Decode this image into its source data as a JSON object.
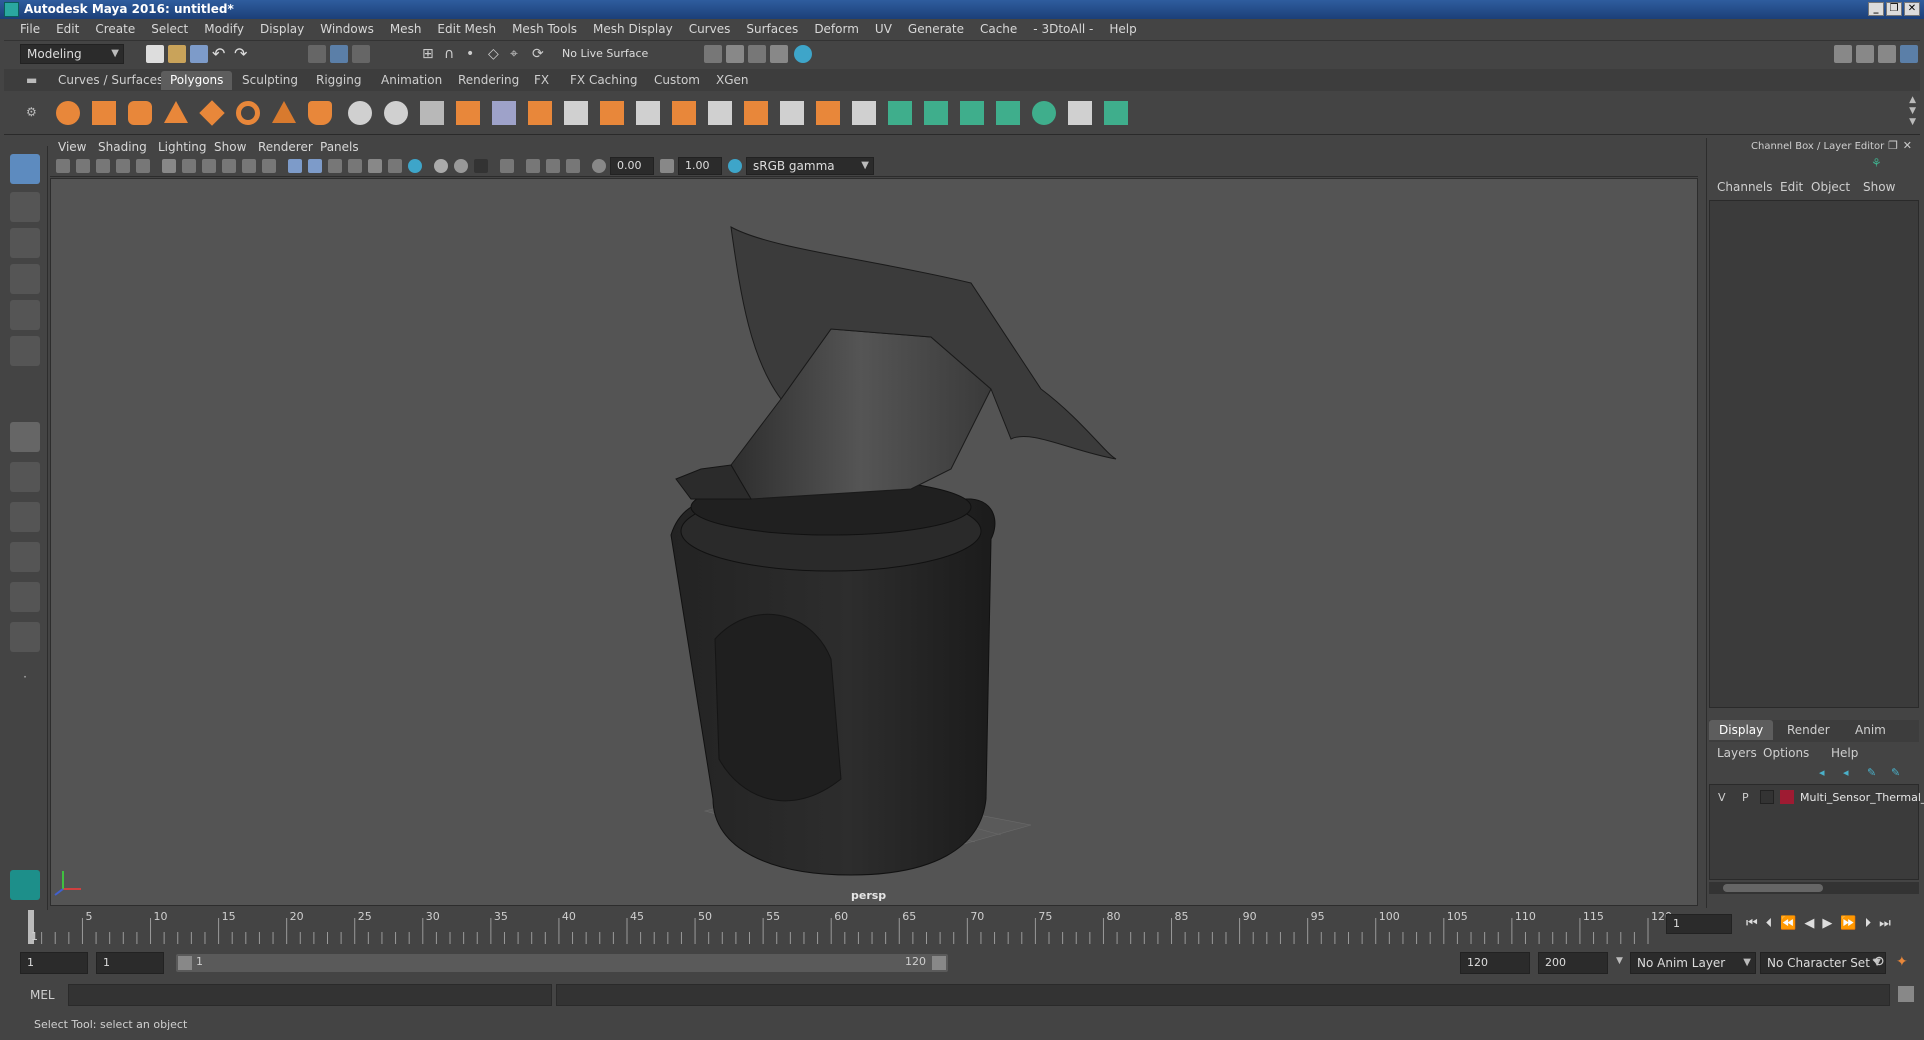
{
  "window": {
    "title": "Autodesk Maya 2016: untitled*",
    "controls": [
      "minimize-icon",
      "restore-icon",
      "close-icon"
    ]
  },
  "menubar": [
    "File",
    "Edit",
    "Create",
    "Select",
    "Modify",
    "Display",
    "Windows",
    "Mesh",
    "Edit Mesh",
    "Mesh Tools",
    "Mesh Display",
    "Curves",
    "Surfaces",
    "Deform",
    "UV",
    "Generate",
    "Cache",
    "- 3DtoAll -",
    "Help"
  ],
  "status": {
    "mode": "Modeling",
    "live_surface": "No Live Surface"
  },
  "shelf": {
    "tabs": [
      "Curves / Surfaces",
      "Polygons",
      "Sculpting",
      "Rigging",
      "Animation",
      "Rendering",
      "FX",
      "FX Caching",
      "Custom",
      "XGen"
    ],
    "active_tab": "Polygons"
  },
  "panel": {
    "menus": [
      "View",
      "Shading",
      "Lighting",
      "Show",
      "Renderer",
      "Panels"
    ],
    "exposure": "0.00",
    "gamma": "1.00",
    "color_space": "sRGB gamma",
    "camera_label": "persp"
  },
  "channel_box": {
    "title": "Channel Box / Layer Editor",
    "menus": [
      "Channels",
      "Edit",
      "Object",
      "Show"
    ]
  },
  "layer_editor": {
    "tabs": [
      "Display",
      "Render",
      "Anim"
    ],
    "active_tab": "Display",
    "menus": [
      "Layers",
      "Options",
      "Help"
    ],
    "layers": [
      {
        "v": "V",
        "p": "P",
        "color": "#9e1b32",
        "name": "Multi_Sensor_Thermal_"
      }
    ]
  },
  "timeline": {
    "ticks": [
      "1",
      "5",
      "10",
      "15",
      "20",
      "25",
      "30",
      "35",
      "40",
      "45",
      "50",
      "55",
      "60",
      "65",
      "70",
      "75",
      "80",
      "85",
      "90",
      "95",
      "100",
      "105",
      "110",
      "115",
      "120"
    ],
    "current_frame": "1"
  },
  "range": {
    "start": "1",
    "playback_start": "1",
    "slider_start": "1",
    "slider_end": "120",
    "playback_end": "120",
    "end": "200",
    "anim_layer": "No Anim Layer",
    "character_set": "No Character Set"
  },
  "command": {
    "language": "MEL"
  },
  "help_line": "Select Tool: select an object",
  "colors": {
    "accent": "#5d5d5d",
    "shelf_icon": "#e8873a",
    "uv_icon": "#3fae8c",
    "model": "#2b2b2b"
  }
}
